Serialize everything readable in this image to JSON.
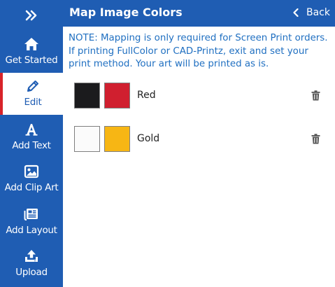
{
  "sidebar": {
    "collapse_icon": "double-chevron-right-icon",
    "items": [
      {
        "label": "Get Started",
        "icon": "home-icon"
      },
      {
        "label": "Edit",
        "icon": "pencil-icon",
        "active": true
      },
      {
        "label": "Add Text",
        "icon": "text-icon"
      },
      {
        "label": "Add Clip Art",
        "icon": "image-icon"
      },
      {
        "label": "Add Layout",
        "icon": "layout-icon"
      },
      {
        "label": "Upload",
        "icon": "upload-icon"
      }
    ]
  },
  "header": {
    "title": "Map Image Colors",
    "back_label": "Back"
  },
  "note": "NOTE: Mapping is only required for Screen Print orders. If printing FullColor or CAD-Printz, exit and set your print method. Your art will be printed as is.",
  "colors": [
    {
      "name": "Red",
      "original": "#1b1b1d",
      "mapped": "#d01f2f"
    },
    {
      "name": "Gold",
      "original": "#fbfbfb",
      "mapped": "#f7b614"
    }
  ],
  "theme": {
    "primary": "#1f5db3",
    "accent": "#d8232a",
    "note_text": "#1f6fc1"
  }
}
